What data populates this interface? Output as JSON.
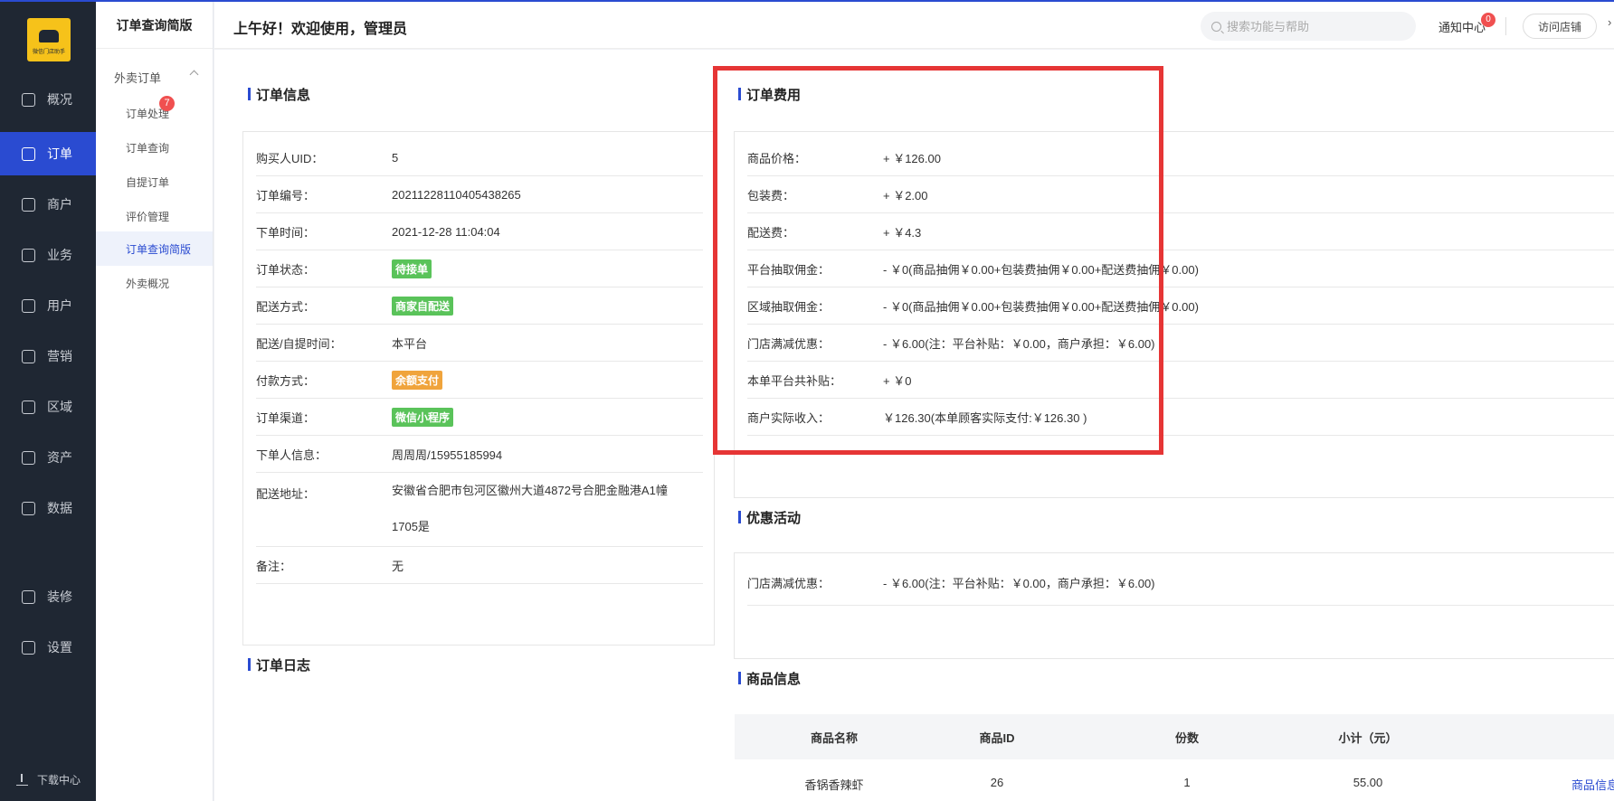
{
  "brand": {
    "logo_text": "微信门店助手"
  },
  "nav": [
    {
      "label": "概况",
      "icon": "overview-icon"
    },
    {
      "label": "订单",
      "icon": "order-icon",
      "active": true
    },
    {
      "label": "商户",
      "icon": "merchant-icon"
    },
    {
      "label": "业务",
      "icon": "business-icon"
    },
    {
      "label": "用户",
      "icon": "user-icon"
    },
    {
      "label": "营销",
      "icon": "marketing-icon"
    },
    {
      "label": "区域",
      "icon": "region-icon"
    },
    {
      "label": "资产",
      "icon": "asset-icon"
    },
    {
      "label": "数据",
      "icon": "data-icon"
    },
    {
      "label": "装修",
      "icon": "decoration-icon"
    },
    {
      "label": "设置",
      "icon": "settings-icon"
    }
  ],
  "download_label": "下载中心",
  "sub_nav": {
    "title": "订单查询简版",
    "group": "外卖订单",
    "badge": "7",
    "items": [
      "订单处理",
      "订单查询",
      "自提订单",
      "评价管理",
      "订单查询简版",
      "外卖概况"
    ]
  },
  "header": {
    "greeting": "上午好！欢迎使用，管理员",
    "search_placeholder": "搜索功能与帮助",
    "notice_label": "通知中心",
    "notice_count": "0",
    "visit_label": "访问店铺"
  },
  "order_info": {
    "title": "订单信息",
    "buyer_uid": {
      "k": "购买人UID：",
      "v": "5"
    },
    "order_no": {
      "k": "订单编号：",
      "v": "20211228110405438265"
    },
    "order_time": {
      "k": "下单时间：",
      "v": "2021-12-28 11:04:04"
    },
    "status": {
      "k": "订单状态：",
      "v": "待接单"
    },
    "delivery_method": {
      "k": "配送方式：",
      "v": "商家自配送"
    },
    "delivery_time": {
      "k": "配送/自提时间：",
      "v": "本平台"
    },
    "payment": {
      "k": "付款方式：",
      "v": "余额支付"
    },
    "channel": {
      "k": "订单渠道：",
      "v": "微信小程序"
    },
    "buyer": {
      "k": "下单人信息：",
      "v": "周周周/15955185994"
    },
    "address": {
      "k": "配送地址：",
      "v1": "安徽省合肥市包河区徽州大道4872号合肥金融港A1幢",
      "v2": "1705是"
    },
    "remark": {
      "k": "备注：",
      "v": "无"
    }
  },
  "order_log": {
    "title": "订单日志"
  },
  "order_fee": {
    "title": "订单费用",
    "rows": [
      {
        "k": "商品价格：",
        "v": "+ ￥126.00"
      },
      {
        "k": "包装费：",
        "v": "+ ￥2.00"
      },
      {
        "k": "配送费：",
        "v": "+ ￥4.3"
      },
      {
        "k": "平台抽取佣金：",
        "v": "- ￥0(商品抽佣￥0.00+包装费抽佣￥0.00+配送费抽佣￥0.00)"
      },
      {
        "k": "区域抽取佣金：",
        "v": "- ￥0(商品抽佣￥0.00+包装费抽佣￥0.00+配送费抽佣￥0.00)"
      },
      {
        "k": "门店满减优惠：",
        "v": "- ￥6.00(注：平台补贴：￥0.00，商户承担：￥6.00)"
      },
      {
        "k": "本单平台共补贴：",
        "v": "+ ￥0"
      },
      {
        "k": "商户实际收入：",
        "v": "￥126.30(本单顾客实际支付:￥126.30 )"
      }
    ]
  },
  "promotion": {
    "title": "优惠活动",
    "k": "门店满减优惠：",
    "v": "- ￥6.00(注：平台补贴：￥0.00，商户承担：￥6.00)"
  },
  "goods": {
    "title": "商品信息",
    "columns": [
      "商品名称",
      "商品ID",
      "份数",
      "小计（元）"
    ],
    "rows": [
      {
        "name": "香锅香辣虾",
        "id": "26",
        "qty": "1",
        "subtotal": "55.00",
        "link": "商品信息"
      }
    ]
  },
  "colors": {
    "accent": "#2a4bd1",
    "sidebar": "#1f2733",
    "highlight_box": "#e63535",
    "tag_green": "#5ac35a",
    "tag_orange": "#f0a43c"
  }
}
